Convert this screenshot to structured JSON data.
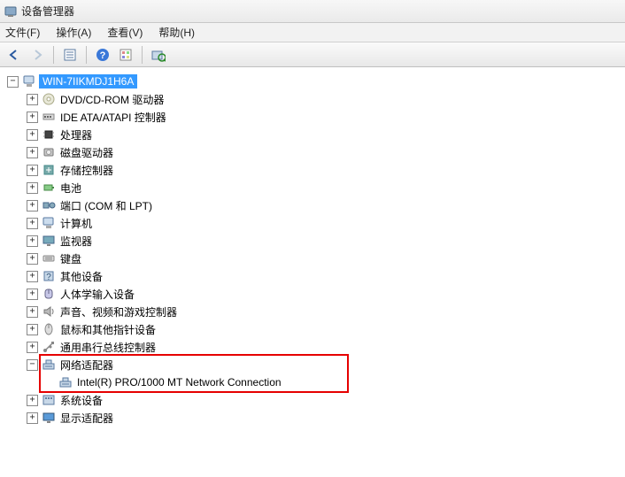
{
  "window": {
    "title": "设备管理器"
  },
  "menu": {
    "file": "文件(F)",
    "action": "操作(A)",
    "view": "查看(V)",
    "help": "帮助(H)"
  },
  "toolbar": {
    "back": "back-icon",
    "forward": "forward-icon",
    "list": "list-icon",
    "help": "help-icon",
    "details": "details-icon",
    "scan": "scan-icon"
  },
  "tree": {
    "root": {
      "label": "WIN-7IIKMDJ1H6A",
      "expanded": true,
      "expander": "−"
    },
    "categories": [
      {
        "label": "DVD/CD-ROM 驱动器",
        "icon": "disc",
        "expander": "+"
      },
      {
        "label": "IDE ATA/ATAPI 控制器",
        "icon": "ide",
        "expander": "+"
      },
      {
        "label": "处理器",
        "icon": "cpu",
        "expander": "+"
      },
      {
        "label": "磁盘驱动器",
        "icon": "disk",
        "expander": "+"
      },
      {
        "label": "存储控制器",
        "icon": "storage",
        "expander": "+"
      },
      {
        "label": "电池",
        "icon": "battery",
        "expander": "+"
      },
      {
        "label": "端口 (COM 和 LPT)",
        "icon": "port",
        "expander": "+"
      },
      {
        "label": "计算机",
        "icon": "computer",
        "expander": "+"
      },
      {
        "label": "监视器",
        "icon": "monitor",
        "expander": "+"
      },
      {
        "label": "键盘",
        "icon": "keyboard",
        "expander": "+"
      },
      {
        "label": "其他设备",
        "icon": "other",
        "expander": "+"
      },
      {
        "label": "人体学输入设备",
        "icon": "hid",
        "expander": "+"
      },
      {
        "label": "声音、视频和游戏控制器",
        "icon": "audio",
        "expander": "+"
      },
      {
        "label": "鼠标和其他指针设备",
        "icon": "mouse",
        "expander": "+"
      },
      {
        "label": "通用串行总线控制器",
        "icon": "usb",
        "expander": "+"
      },
      {
        "label": "网络适配器",
        "icon": "network",
        "expander": "−",
        "children": [
          {
            "label": "Intel(R) PRO/1000 MT Network Connection",
            "icon": "network"
          }
        ]
      },
      {
        "label": "系统设备",
        "icon": "system",
        "expander": "+"
      },
      {
        "label": "显示适配器",
        "icon": "display",
        "expander": "+"
      }
    ]
  }
}
